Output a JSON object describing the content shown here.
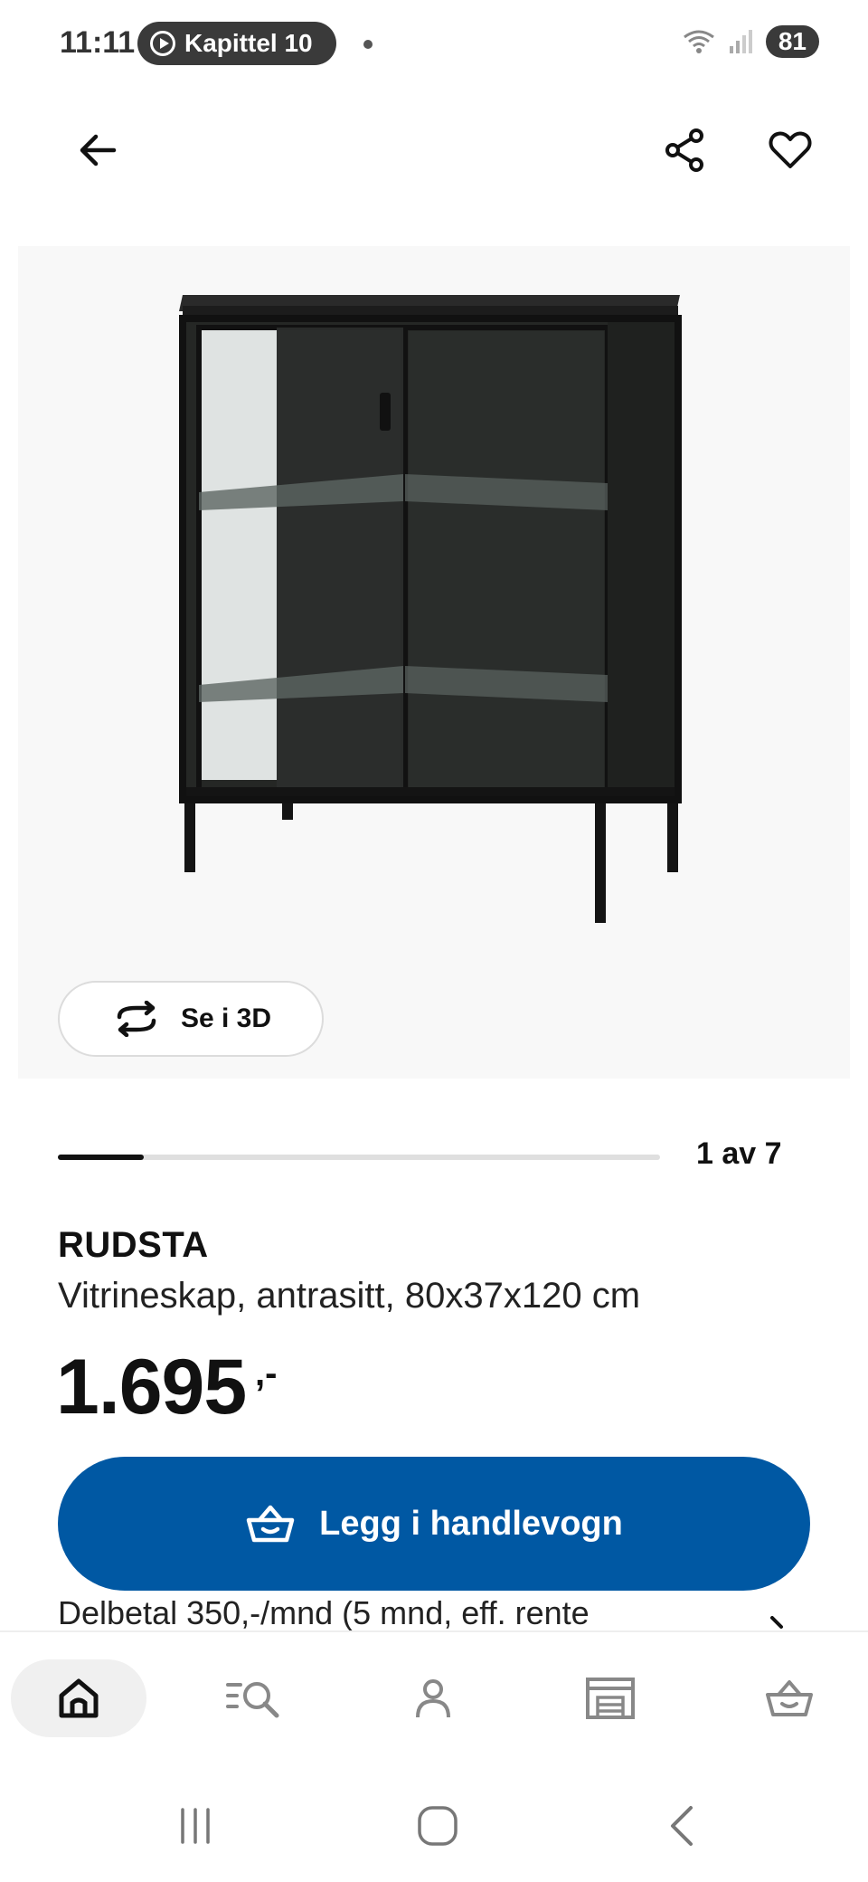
{
  "status": {
    "time": "11:11",
    "media_pill": "Kapittel 10",
    "battery": "81"
  },
  "product": {
    "image_counter": "1 av 7",
    "image_progress": 0.143,
    "view_3d_label": "Se i 3D",
    "name": "RUDSTA",
    "description": "Vitrineskap, antrasitt, 80x37x120 cm",
    "price": "1.695",
    "price_suffix": ",-",
    "add_to_cart_label": "Legg i handlevogn",
    "installment_text": "Delbetal 350,-/mnd (5 mnd, eff. rente"
  },
  "colors": {
    "brand_blue": "#0058a3",
    "text": "#111111",
    "cabinet": "#1f211f"
  },
  "icons": {
    "back": "arrow-left",
    "share": "share",
    "favorite": "heart",
    "rotate": "rotate-3d",
    "cart": "basket",
    "nav": [
      "home",
      "search-list",
      "profile",
      "store",
      "basket"
    ]
  }
}
